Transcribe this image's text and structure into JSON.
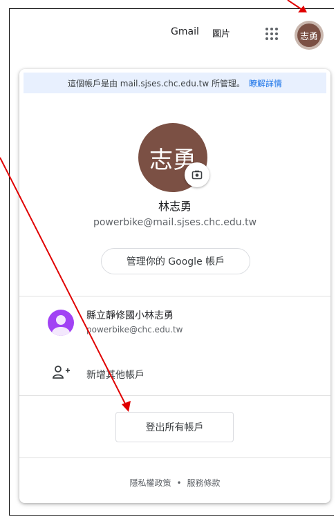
{
  "header": {
    "gmail": "Gmail",
    "images": "圖片",
    "avatar_text": "志勇"
  },
  "banner": {
    "text": "這個帳戶是由 mail.sjses.chc.edu.tw 所管理。",
    "link": "瞭解詳情"
  },
  "profile": {
    "avatar_text": "志勇",
    "name": "林志勇",
    "email": "powerbike@mail.sjses.chc.edu.tw",
    "manage_label": "管理你的 Google 帳戶"
  },
  "accounts": [
    {
      "name": "縣立靜修國小林志勇",
      "email": "powerbike@chc.edu.tw"
    }
  ],
  "add_account_label": "新增其他帳戶",
  "signout_label": "登出所有帳戶",
  "footer": {
    "privacy": "隱私權政策",
    "separator": "•",
    "terms": "服務條款"
  },
  "colors": {
    "accent": "#1a73e8",
    "avatar_brown": "#7b5044",
    "account_purple": "#a142f4",
    "annotation_red": "#e00000"
  }
}
